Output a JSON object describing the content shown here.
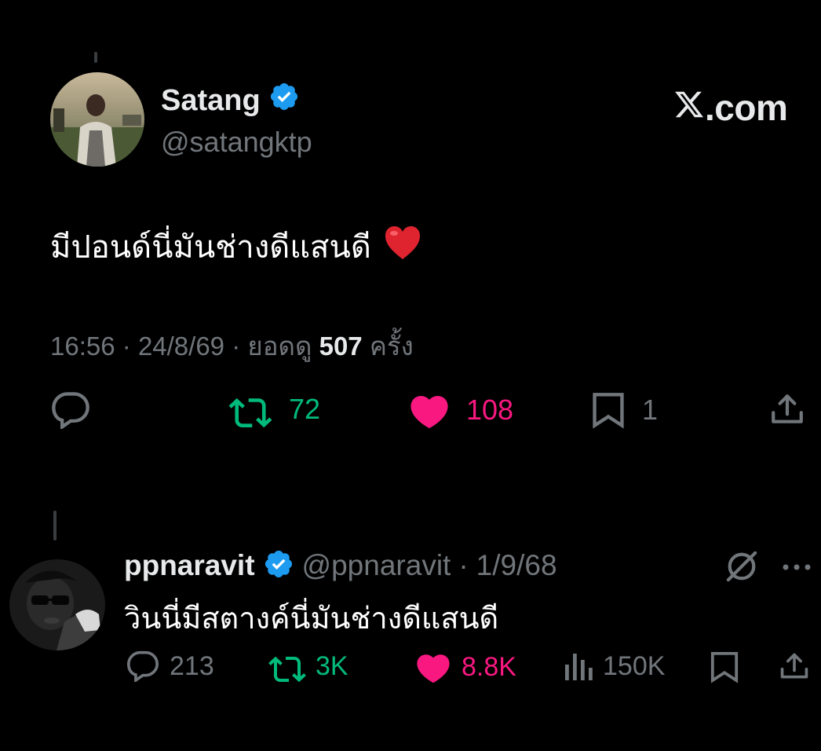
{
  "colors": {
    "background": "#000000",
    "text_primary": "#e7e9ea",
    "text_secondary": "#71767b",
    "verified_blue": "#1d9bf0",
    "retweet_green": "#00ba7c",
    "like_pink": "#f91880"
  },
  "brand": {
    "label": ".com",
    "icon": "x-logo-icon"
  },
  "tweet": {
    "author_name": "Satang",
    "author_handle": "@satangktp",
    "verified_icon": "verified-badge-icon",
    "text": "มีปอนด์นี่มันช่างดีแสนดี",
    "emoji": "❤️",
    "time": "16:56",
    "date": "24/8/69",
    "views_prefix": "ยอดดู",
    "views_count": "507",
    "views_suffix": "ครั้ง",
    "separator": "·",
    "actions": {
      "reply": {
        "icon": "reply-icon"
      },
      "retweet": {
        "icon": "retweet-icon",
        "count": "72"
      },
      "like": {
        "icon": "heart-icon",
        "count": "108"
      },
      "bookmark": {
        "icon": "bookmark-icon",
        "count": "1"
      },
      "share": {
        "icon": "share-icon"
      }
    }
  },
  "reply": {
    "author_name": "ppnaravit",
    "author_handle": "@ppnaravit",
    "separator": "·",
    "date": "1/9/68",
    "text": "วินนี่มีสตางค์นี่มันช่างดีแสนดี",
    "actions": {
      "reply": {
        "icon": "reply-icon",
        "count": "213"
      },
      "retweet": {
        "icon": "retweet-icon",
        "count": "3K"
      },
      "like": {
        "icon": "heart-icon",
        "count": "8.8K"
      },
      "views": {
        "icon": "analytics-icon",
        "count": "150K"
      },
      "bookmark": {
        "icon": "bookmark-icon"
      },
      "share": {
        "icon": "share-icon"
      }
    },
    "grok_icon": "grok-icon",
    "more_icon": "more-icon"
  }
}
